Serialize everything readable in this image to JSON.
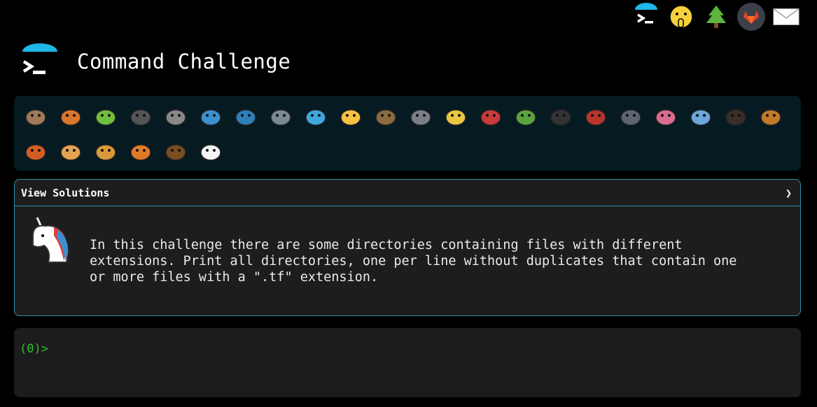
{
  "header": {
    "title": "Command Challenge"
  },
  "nav": {
    "items": [
      {
        "name": "terminal-icon"
      },
      {
        "name": "shush-face-icon"
      },
      {
        "name": "tree-icon"
      },
      {
        "name": "gitlab-icon"
      },
      {
        "name": "mail-icon"
      }
    ]
  },
  "animals": [
    "snail",
    "butterfly",
    "caterpillar",
    "ant",
    "spider-web",
    "whale",
    "shark",
    "dolphin",
    "fish",
    "tropical-fish",
    "blowfish",
    "wolf",
    "bee",
    "ladybug",
    "cricket",
    "spider",
    "scorpion",
    "fly",
    "worm",
    "microbe",
    "monkey",
    "dog",
    "fox",
    "cat",
    "lion",
    "tiger",
    "horse",
    "unicorn"
  ],
  "panel": {
    "heading": "View Solutions",
    "chevron": "❯",
    "description": "In this challenge there are some directories containing files with different\nextensions. Print all directories, one per line without duplicates that contain one\nor more files with a \".tf\" extension."
  },
  "terminal": {
    "prompt": "(0)>",
    "input": ""
  },
  "colors": {
    "accent": "#2a8fb5",
    "prompt": "#2fc12f",
    "panel_bg": "#1d1d1d",
    "animals_bg": "#061a22"
  }
}
